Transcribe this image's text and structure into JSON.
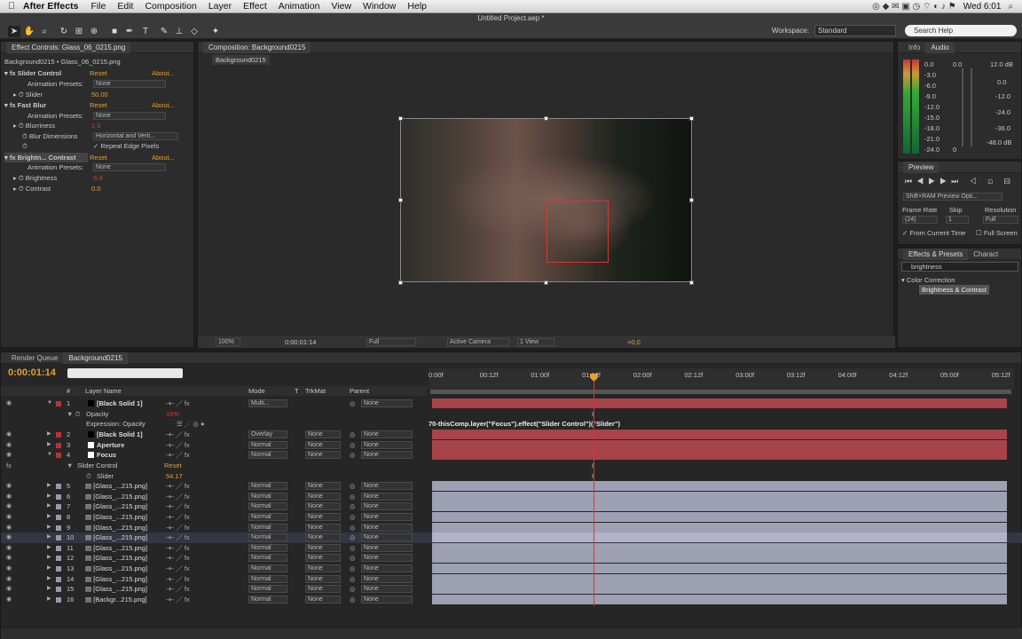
{
  "menubar": {
    "app": "After Effects",
    "items": [
      "File",
      "Edit",
      "Composition",
      "Layer",
      "Effect",
      "Animation",
      "View",
      "Window",
      "Help"
    ],
    "clock": "Wed 6:01"
  },
  "toolbar": {
    "doc_title": "Untitled Project.aep *",
    "workspace_label": "Workspace:",
    "workspace_value": "Standard",
    "search_placeholder": "Search Help"
  },
  "effect_controls": {
    "tab": "Effect Controls: Glass_06_0215.png",
    "source": "Background0215 • Glass_06_0215.png",
    "effects": [
      {
        "name": "Slider Control",
        "reset": "Reset",
        "about": "About...",
        "presets_label": "Animation Presets:",
        "presets": "None",
        "param": "Slider",
        "value": "50.00"
      },
      {
        "name": "Fast Blur",
        "reset": "Reset",
        "about": "About...",
        "presets_label": "Animation Presets:",
        "presets": "None",
        "params": [
          {
            "label": "Blurriness",
            "value": "2.9"
          },
          {
            "label": "Blur Dimensions",
            "value": "Horizontal and Verti..."
          }
        ],
        "checkbox": "Repeat Edge Pixels"
      },
      {
        "name": "Brightn... Contrast",
        "reset": "Reset",
        "about": "About...",
        "presets_label": "Animation Presets:",
        "presets": "None",
        "params": [
          {
            "label": "Brightness",
            "value": "-5.8"
          },
          {
            "label": "Contrast",
            "value": "0.0"
          }
        ]
      }
    ]
  },
  "composition": {
    "tab": "Composition: Background0215",
    "subtab": "Background0215",
    "zoom": "100%",
    "timecode": "0:00:01:14",
    "resolution": "Full",
    "camera": "Active Camera",
    "views": "1 View",
    "exposure": "+0.0"
  },
  "info_audio": {
    "tabs": [
      "Info",
      "Audio"
    ],
    "left_scale": [
      "0.0",
      "-3.0",
      "-6.0",
      "-9.0",
      "-12.0",
      "-15.0",
      "-18.0",
      "-21.0",
      "-24.0"
    ],
    "right_scale": [
      "12.0 dB",
      "0.0",
      "-12.0",
      "-24.0",
      "-36.0",
      "-48.0 dB"
    ],
    "mid_scale": [
      "0.0",
      "0"
    ]
  },
  "preview": {
    "title": "Preview",
    "mode": "Shift+RAM Preview Opti...",
    "frame_rate_label": "Frame Rate",
    "frame_rate": "(24)",
    "skip_label": "Skip",
    "skip": "1",
    "resolution_label": "Resolution",
    "resolution": "Full",
    "from_current": "From Current Time",
    "full_screen": "Full Screen"
  },
  "effects_presets": {
    "tabs": [
      "Effects & Presets",
      "Charact"
    ],
    "search": "brightness",
    "category": "Color Correction",
    "item": "Brightness & Contrast"
  },
  "timeline": {
    "tabs": [
      "Render Queue",
      "Background0215"
    ],
    "timecode": "0:00:01:14",
    "headers": {
      "num": "#",
      "layer": "Layer Name",
      "mode": "Mode",
      "t": "T",
      "trkmat": "TrkMat",
      "parent": "Parent"
    },
    "ruler": [
      "0:00f",
      "00:12f",
      "01:00f",
      "01:12f",
      "02:00f",
      "02:12f",
      "03:00f",
      "03:12f",
      "04:00f",
      "04:12f",
      "05:00f",
      "05:12f"
    ],
    "expression": "70-thisComp.layer(\"Focus\").effect(\"Slider Control\")(\"Slider\")",
    "layers": [
      {
        "num": "1",
        "name": "[Black Solid 1]",
        "mode": "Multi...",
        "trkmat": "",
        "parent": "None",
        "color": "#b33"
      },
      {
        "num": "2",
        "name": "[Black Solid 1]",
        "mode": "Overlay",
        "trkmat": "None",
        "parent": "None",
        "color": "#b33"
      },
      {
        "num": "3",
        "name": "Aperture",
        "mode": "Normal",
        "trkmat": "None",
        "parent": "None",
        "color": "#b33"
      },
      {
        "num": "4",
        "name": "Focus",
        "mode": "Normal",
        "trkmat": "None",
        "parent": "None",
        "color": "#b33"
      },
      {
        "num": "5",
        "name": "[Glass_...215.png]",
        "mode": "Normal",
        "trkmat": "None",
        "parent": "None",
        "color": "#99a"
      },
      {
        "num": "6",
        "name": "[Glass_...215.png]",
        "mode": "Normal",
        "trkmat": "None",
        "parent": "None",
        "color": "#99a"
      },
      {
        "num": "7",
        "name": "[Glass_...215.png]",
        "mode": "Normal",
        "trkmat": "None",
        "parent": "None",
        "color": "#99a"
      },
      {
        "num": "8",
        "name": "[Glass_...215.png]",
        "mode": "Normal",
        "trkmat": "None",
        "parent": "None",
        "color": "#99a"
      },
      {
        "num": "9",
        "name": "[Glass_...215.png]",
        "mode": "Normal",
        "trkmat": "None",
        "parent": "None",
        "color": "#99a"
      },
      {
        "num": "10",
        "name": "[Glass_...215.png]",
        "mode": "Normal",
        "trkmat": "None",
        "parent": "None",
        "color": "#99a"
      },
      {
        "num": "11",
        "name": "[Glass_...215.png]",
        "mode": "Normal",
        "trkmat": "None",
        "parent": "None",
        "color": "#99a"
      },
      {
        "num": "12",
        "name": "[Glass_...215.png]",
        "mode": "Normal",
        "trkmat": "None",
        "parent": "None",
        "color": "#99a"
      },
      {
        "num": "13",
        "name": "[Glass_...215.png]",
        "mode": "Normal",
        "trkmat": "None",
        "parent": "None",
        "color": "#99a"
      },
      {
        "num": "14",
        "name": "[Glass_...215.png]",
        "mode": "Normal",
        "trkmat": "None",
        "parent": "None",
        "color": "#99a"
      },
      {
        "num": "15",
        "name": "[Glass_...215.png]",
        "mode": "Normal",
        "trkmat": "None",
        "parent": "None",
        "color": "#99a"
      },
      {
        "num": "16",
        "name": "[Backgr...215.png]",
        "mode": "Normal",
        "trkmat": "None",
        "parent": "None",
        "color": "#99a"
      }
    ],
    "sub": {
      "opacity_label": "Opacity",
      "opacity_value": "16%",
      "expr_label": "Expression: Opacity",
      "slider_control": "Slider Control",
      "slider_reset": "Reset",
      "slider_label": "Slider",
      "slider_value": "54.17"
    }
  }
}
